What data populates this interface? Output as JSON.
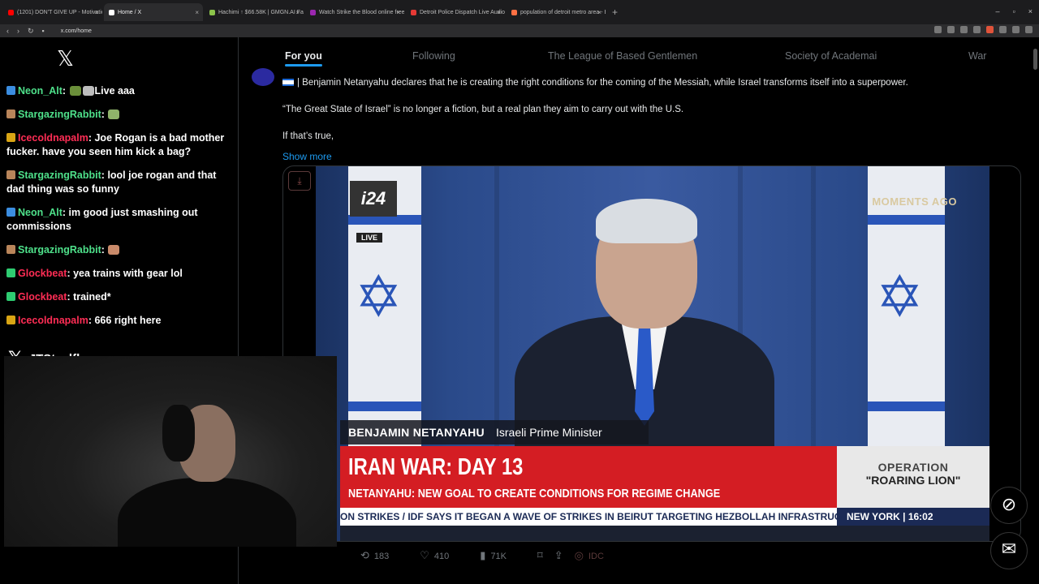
{
  "browser": {
    "tabs": [
      {
        "title": "(1201) DON'T GIVE UP - Motivatio",
        "color": "#ff0000"
      },
      {
        "title": "Home / X",
        "color": "#ffffff"
      },
      {
        "title": "Hachimi ↑ $66.58K | GMGN.AI Fast Tr",
        "color": "#8bc34a"
      },
      {
        "title": "Watch Strike the Blood online free o",
        "color": "#9c27b0"
      },
      {
        "title": "Detroit Police Dispatch Live Audio Fe",
        "color": "#e53935"
      },
      {
        "title": "population of detroit metro area - B",
        "color": "#ff7043"
      }
    ],
    "new_tab": "+",
    "url": "x.com/home"
  },
  "chat": {
    "messages": [
      {
        "user": "Neon_Alt",
        "user_color": "#4ee08a",
        "badge_color": "#3b8de0",
        "text": "Live aaa",
        "emotes": [
          "#6b8f3a",
          "#bdbdbd"
        ]
      },
      {
        "user": "StargazingRabbit",
        "user_color": "#4ee08a",
        "badge_color": "#b9855a",
        "text": "",
        "emotes": [
          "#8fb36a"
        ]
      },
      {
        "user": "Icecoldnapalm",
        "user_color": "#ff2d55",
        "badge_color": "#d9a514",
        "text": "Joe Rogan is a bad mother fucker. have you seen him kick a bag?",
        "emotes": []
      },
      {
        "user": "StargazingRabbit",
        "user_color": "#4ee08a",
        "badge_color": "#b9855a",
        "text": "lool joe rogan and that dad thing was so funny",
        "emotes": []
      },
      {
        "user": "Neon_Alt",
        "user_color": "#4ee08a",
        "badge_color": "#3b8de0",
        "text": "im good just smashing out commissions",
        "emotes": []
      },
      {
        "user": "StargazingRabbit",
        "user_color": "#4ee08a",
        "badge_color": "#b9855a",
        "text": "",
        "emotes": [
          "#c98a6a"
        ]
      },
      {
        "user": "Glockbeat",
        "user_color": "#ff2d55",
        "badge_color": "#2ecc71",
        "text": "yea trains with gear lol",
        "emotes": []
      },
      {
        "user": "Glockbeat",
        "user_color": "#ff2d55",
        "badge_color": "#2ecc71",
        "text": "trained*",
        "emotes": []
      },
      {
        "user": "Icecoldnapalm",
        "user_color": "#ff2d55",
        "badge_color": "#d9a514",
        "text": "666 right here",
        "emotes": []
      }
    ],
    "streamer_handle": "JTSteelflex"
  },
  "feed": {
    "tabs": [
      "For you",
      "Following",
      "The League of Based Gentlemen",
      "Society of Academai",
      "War"
    ],
    "post": {
      "line1": "| Benjamin Netanyahu declares that he is creating the right conditions for the coming of the Messiah, while Israel transforms itself into a superpower.",
      "line2": "“The Great State of Israel” is no longer a fiction, but a real plan they aim to carry out with the U.S.",
      "line3": "If that’s true,",
      "show_more": "Show more"
    },
    "video": {
      "channel": "i24",
      "live": "LIVE",
      "moments": "MOMENTS AGO",
      "name": "BENJAMIN NETANYAHU",
      "role": "Israeli Prime Minister",
      "headline": "IRAN WAR: DAY 13",
      "subheadline": "NETANYAHU: NEW GOAL TO CREATE CONDITIONS FOR REGIME CHANGE",
      "op1": "OPERATION",
      "op2": "\"ROARING LION\"",
      "ticker": "ON STRIKES  /  IDF SAYS IT BEGAN A WAVE OF STRIKES IN BEIRUT TARGETING HEZBOLLAH INFRASTRUCT",
      "city": "NEW YORK",
      "time": "16:02"
    },
    "actions": {
      "reposts": "183",
      "likes": "410",
      "views": "71K",
      "extra": "IDC"
    }
  }
}
